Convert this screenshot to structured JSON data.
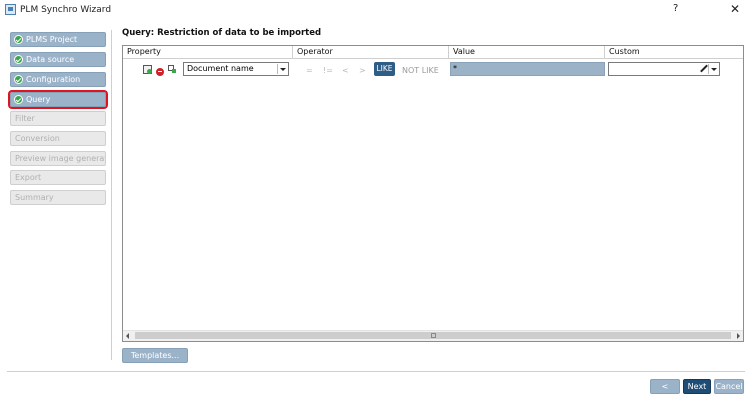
{
  "window": {
    "title": "PLM Synchro Wizard",
    "help_label": "?",
    "close_label": "✕"
  },
  "steps": [
    {
      "label": "PLMS Project",
      "state": "done"
    },
    {
      "label": "Data source",
      "state": "done"
    },
    {
      "label": "Configuration",
      "state": "done"
    },
    {
      "label": "Query",
      "state": "active"
    },
    {
      "label": "Filter",
      "state": "disabled"
    },
    {
      "label": "Conversion",
      "state": "disabled"
    },
    {
      "label": "Preview image generation",
      "state": "disabled"
    },
    {
      "label": "Export",
      "state": "disabled"
    },
    {
      "label": "Summary",
      "state": "disabled"
    }
  ],
  "main": {
    "heading": "Query: Restriction of data to be imported",
    "columns": {
      "property": "Property",
      "operator": "Operator",
      "value": "Value",
      "custom": "Custom"
    },
    "row": {
      "property": "Document name",
      "operators": {
        "eq": "=",
        "ne": "!=",
        "lt": "<",
        "gt": ">",
        "like": "LIKE",
        "notlike": "NOT LIKE"
      },
      "value": "*",
      "custom": ""
    },
    "templates_label": "Templates..."
  },
  "footer": {
    "back": "< Back",
    "next": "Next >",
    "cancel": "Cancel"
  },
  "colors": {
    "accent": "#9bb3c9",
    "primary": "#1f4d75",
    "active_outline": "#e0141f",
    "check": "#3aa84a"
  }
}
